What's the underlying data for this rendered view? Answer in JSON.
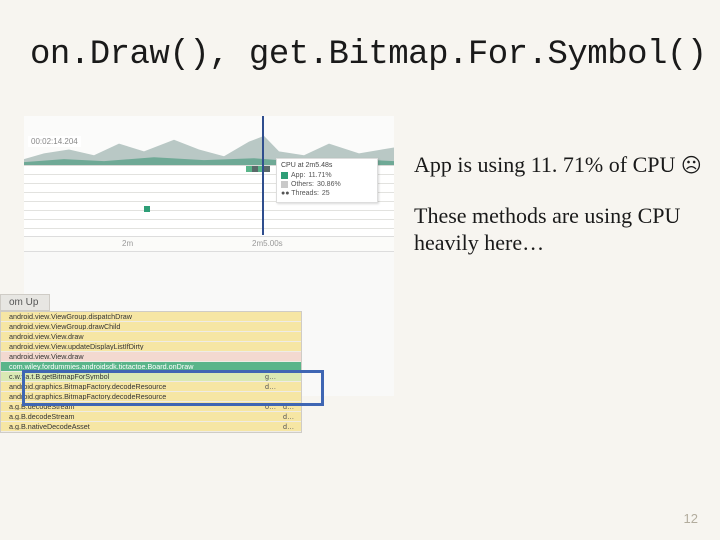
{
  "title": "on.Draw(), get.Bitmap.For.Symbol()",
  "commentary": {
    "line1": "App is using 11. 71% of CPU ",
    "sad": "☹",
    "line2": "These methods are using CPU heavily here…"
  },
  "profiler": {
    "timecode": "00:02:14.204",
    "tooltip": {
      "title": "CPU at 2m5.48s",
      "app_label": "App:",
      "app_value": "11.71%",
      "others_label": "Others:",
      "others_value": "30.86%",
      "threads_label": "●● Threads:",
      "threads_value": "25"
    },
    "axis": {
      "t1": "2m",
      "t2": "2m5.00s"
    },
    "bottomup_tab": "om Up",
    "rows": [
      {
        "cls": "row-yel",
        "c1": "android.view.ViewGroup.dispatchDraw",
        "c2": "",
        "c3": ""
      },
      {
        "cls": "row-yel",
        "c1": "android.view.ViewGroup.drawChild",
        "c2": "",
        "c3": ""
      },
      {
        "cls": "row-yel",
        "c1": "android.view.View.draw",
        "c2": "",
        "c3": ""
      },
      {
        "cls": "row-yel",
        "c1": "android.view.View.updateDisplayListIfDirty",
        "c2": "",
        "c3": ""
      },
      {
        "cls": "row-pnk",
        "c1": "android.view.View.draw",
        "c2": "",
        "c3": ""
      },
      {
        "cls": "row-hi",
        "c1": "com.wiley.fordummies.androidsdk.tictactoe.Board.onDraw",
        "c2": "",
        "c3": ""
      },
      {
        "cls": "row-grn",
        "c1": "c.w.f.a.t.B.getBitmapForSymbol",
        "c2": "g…",
        "c3": ""
      },
      {
        "cls": "row-yel",
        "c1": "android.graphics.BitmapFactory.decodeResource",
        "c2": "d…",
        "c3": ""
      },
      {
        "cls": "row-yel",
        "c1": "android.graphics.BitmapFactory.decodeResource",
        "c2": "",
        "c3": ""
      },
      {
        "cls": "row-yel",
        "c1": "a.g.B.decodeStream",
        "c2": "o…",
        "c3": "d…"
      },
      {
        "cls": "row-yel",
        "c1": "a.g.B.decodeStream",
        "c2": "",
        "c3": "d…"
      },
      {
        "cls": "row-yel",
        "c1": "a.g.B.nativeDecodeAsset",
        "c2": "",
        "c3": "d…"
      }
    ]
  },
  "slidenum": "12"
}
